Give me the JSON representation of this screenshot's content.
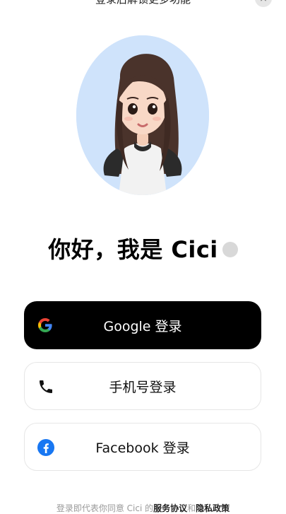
{
  "header": {
    "title": "登录后解锁更多功能",
    "close_label": "×"
  },
  "greeting": {
    "text": "你好，我是 Cici"
  },
  "buttons": {
    "google": "Google 登录",
    "phone": "手机号登录",
    "facebook": "Facebook 登录"
  },
  "legal": {
    "prefix": "登录即代表你同意 Cici 的",
    "terms": "服务协议",
    "and": "和",
    "privacy": "隐私政策"
  },
  "icons": {
    "google": "google-icon",
    "phone": "phone-icon",
    "facebook": "facebook-icon"
  },
  "colors": {
    "google_button_bg": "#000000",
    "avatar_bg": "#cfe3fb",
    "facebook_blue": "#1877f2"
  }
}
